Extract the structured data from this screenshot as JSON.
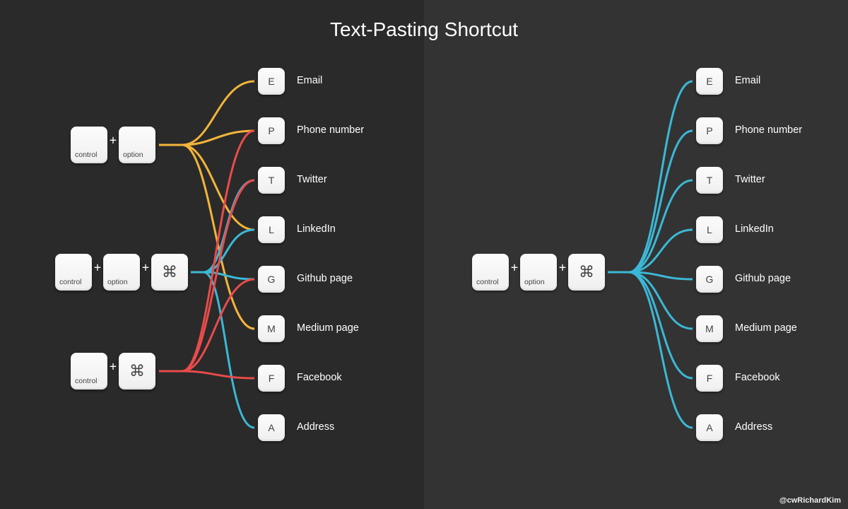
{
  "title": "Text-Pasting Shortcut",
  "credit": "@cwRichardKim",
  "key_labels": {
    "control": "control",
    "option": "option",
    "cmd": "⌘",
    "plus": "+"
  },
  "targets": [
    {
      "key": "E",
      "label": "Email"
    },
    {
      "key": "P",
      "label": "Phone number"
    },
    {
      "key": "T",
      "label": "Twitter"
    },
    {
      "key": "L",
      "label": "LinkedIn"
    },
    {
      "key": "G",
      "label": "Github page"
    },
    {
      "key": "M",
      "label": "Medium page"
    },
    {
      "key": "F",
      "label": "Facebook"
    },
    {
      "key": "A",
      "label": "Address"
    }
  ],
  "colors": {
    "yellow": "#f2b53a",
    "red": "#e94b4b",
    "cyan": "#3bb8d6"
  },
  "left_panel": {
    "combos": [
      {
        "keys": [
          "control",
          "option"
        ],
        "color": "yellow",
        "targets": [
          "E",
          "P",
          "L",
          "M"
        ]
      },
      {
        "keys": [
          "control",
          "option",
          "cmd"
        ],
        "color": "cyan",
        "targets": [
          "T",
          "L",
          "G",
          "A"
        ]
      },
      {
        "keys": [
          "control",
          "cmd"
        ],
        "color": "red",
        "targets": [
          "P",
          "T",
          "G",
          "F"
        ]
      }
    ]
  },
  "right_panel": {
    "combo": {
      "keys": [
        "control",
        "option",
        "cmd"
      ],
      "color": "cyan",
      "targets": [
        "E",
        "P",
        "T",
        "L",
        "G",
        "M",
        "F",
        "A"
      ]
    }
  }
}
